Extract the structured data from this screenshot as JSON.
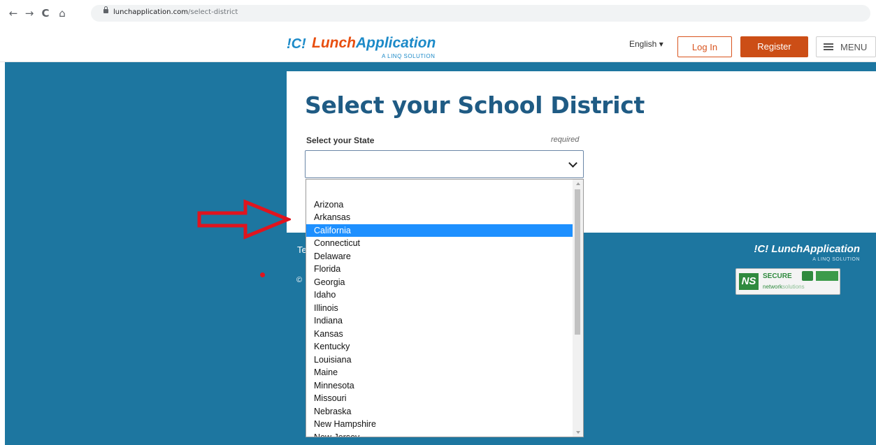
{
  "browser": {
    "back": "←",
    "forward": "→",
    "reload": "C",
    "home": "⌂",
    "url_domain": "lunchapplication.com",
    "url_path": "/select-district"
  },
  "header": {
    "logo_mark": "!C!",
    "logo_lunch": "Lunch",
    "logo_application": "Application",
    "logo_sub": "A LINQ SOLUTION",
    "language": "English ▾",
    "login": "Log In",
    "register": "Register",
    "menu": "MENU"
  },
  "form": {
    "title": "Select your School District",
    "state_label": "Select your State",
    "required": "required",
    "selected_value": ""
  },
  "dropdown": {
    "options": [
      "",
      "Arizona",
      "Arkansas",
      "California",
      "Connecticut",
      "Delaware",
      "Florida",
      "Georgia",
      "Idaho",
      "Illinois",
      "Indiana",
      "Kansas",
      "Kentucky",
      "Louisiana",
      "Maine",
      "Minnesota",
      "Missouri",
      "Nebraska",
      "New Hampshire",
      "New Jersey"
    ],
    "highlighted": "California"
  },
  "footer": {
    "partial_text": "Te",
    "copyright": "©",
    "logo_main": "!C! LunchApplication",
    "logo_sub": "A LINQ SOLUTION",
    "badge_ns": "NS",
    "badge_secure": "SECURE",
    "badge_network": "network",
    "badge_solutions": "solutions"
  },
  "colors": {
    "brand_blue": "#1c8ac8",
    "brand_orange": "#e84e0f",
    "background": "#1d76a0",
    "highlight": "#1e90ff",
    "annotation_red": "#e0141e"
  }
}
